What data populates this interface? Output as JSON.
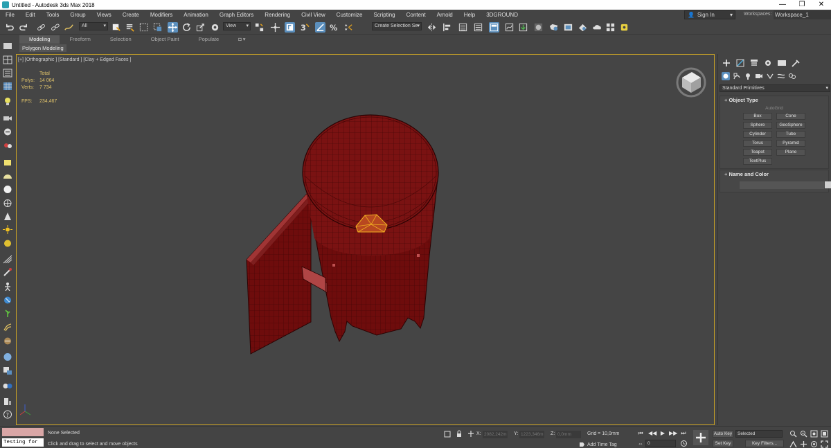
{
  "window": {
    "title": "Untitled - Autodesk 3ds Max 2018",
    "controls": [
      "—",
      "❐",
      "✕"
    ]
  },
  "menu": {
    "items": [
      "File",
      "Edit",
      "Tools",
      "Group",
      "Views",
      "Create",
      "Modifiers",
      "Animation",
      "Graph Editors",
      "Rendering",
      "Civil View",
      "Customize",
      "Scripting",
      "Content",
      "Arnold",
      "Help",
      "3DGROUND"
    ],
    "signin": "Sign In",
    "workspaces_label": "Workspaces:",
    "workspace_value": "Workspace_1"
  },
  "toolbar": {
    "selection_filter": "All",
    "ref_coord": "View",
    "named_selection": "Create Selection Se"
  },
  "ribbon": {
    "tabs": [
      "Modeling",
      "Freeform",
      "Selection",
      "Object Paint",
      "Populate"
    ],
    "active_tab": "Modeling",
    "sub_label": "Polygon Modeling"
  },
  "viewport": {
    "label": "[+] [Orthographic ] [Standard ] [Clay + Edged Faces ]",
    "stats": {
      "header": "Total",
      "polys_label": "Polys:",
      "polys": "14 064",
      "verts_label": "Verts:",
      "verts": "7 734",
      "fps_label": "FPS:",
      "fps": "234,467"
    }
  },
  "command_panel": {
    "category": "Standard Primitives",
    "object_type_title": "Object Type",
    "autogrid": "AutoGrid",
    "primitives": [
      "Box",
      "Cone",
      "Sphere",
      "GeoSphere",
      "Cylinder",
      "Tube",
      "Torus",
      "Pyramid",
      "Teapot",
      "Plane",
      "TextPlus"
    ],
    "name_color_title": "Name and Color"
  },
  "status": {
    "maxscript_text": "Testing for :",
    "selection": "None Selected",
    "prompt": "Click and drag to select and move objects",
    "x_label": "X:",
    "x_value": "2082,242m",
    "y_label": "Y:",
    "y_value": "1223,346m",
    "z_label": "Z:",
    "z_value": "0,0mm",
    "grid": "Grid = 10,0mm",
    "add_time_tag": "Add Time Tag",
    "frame": "0",
    "auto_key": "Auto Key",
    "set_key": "Set Key",
    "key_mode": "Selected",
    "key_filters": "Key Filters..."
  }
}
